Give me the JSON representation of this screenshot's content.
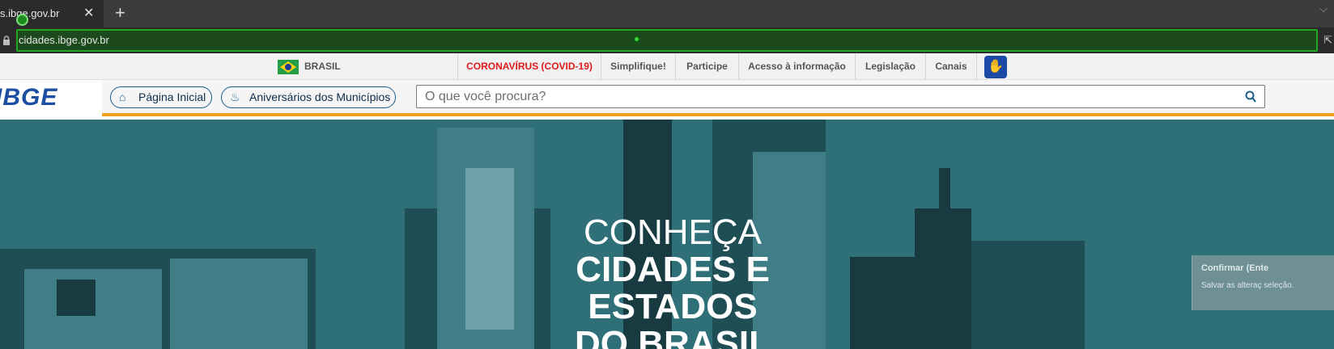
{
  "browser": {
    "tab_title": "s.ibge.gov.br",
    "tab_close": "✕",
    "new_tab": "+",
    "url": "cidades.ibge.gov.br",
    "dropdown": "⌵"
  },
  "gov_bar": {
    "country": "BRASIL",
    "links": [
      "CORONAVÍRUS (COVID-19)",
      "Simplifique!",
      "Participe",
      "Acesso à informação",
      "Legislação",
      "Canais"
    ],
    "covid_color": "#e11a1a"
  },
  "header": {
    "logo": "IBGE",
    "home_label": "Página Inicial",
    "anniversaries_label": "Aniversários dos Municípios",
    "search_placeholder": "O que você procura?",
    "accent_color": "#f0a021"
  },
  "hero": {
    "line1": "CONHEÇA",
    "line2": "CIDADES E",
    "line3": "ESTADOS",
    "line4": "DO BRASIL"
  },
  "popup": {
    "title": "Confirmar (Ente",
    "body": "Salvar as alteraç seleção."
  }
}
